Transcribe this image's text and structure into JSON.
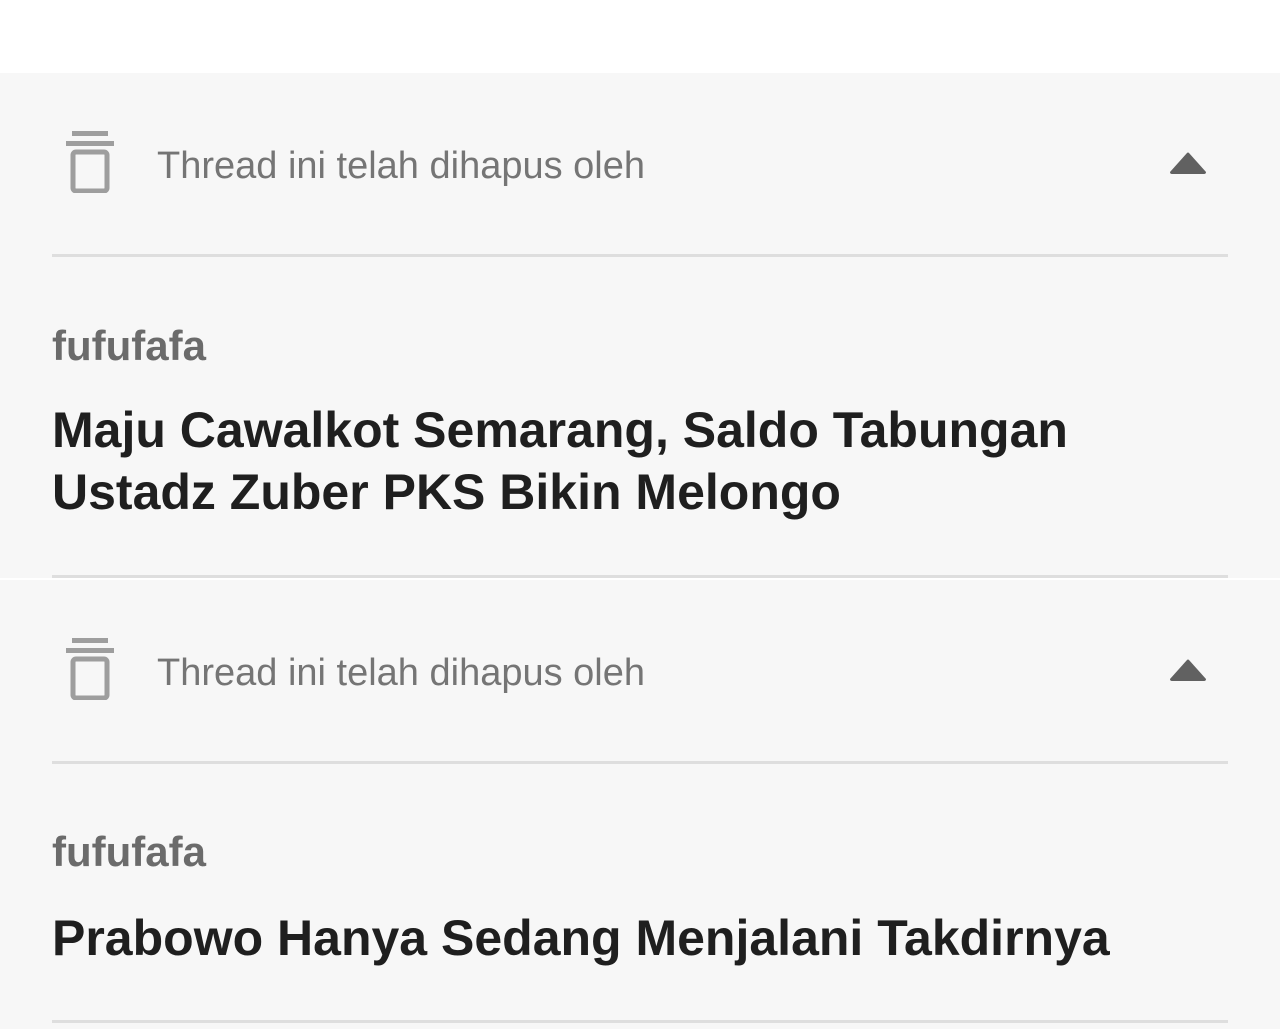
{
  "threads": [
    {
      "deleted_notice": "Thread ini telah dihapus oleh",
      "trash_icon": "trash-icon",
      "collapse_icon": "caret-up-icon",
      "author": "fufufafa",
      "title": "Maju Cawalkot Semarang, Saldo Tabungan Ustadz Zuber PKS Bikin Melongo"
    },
    {
      "deleted_notice": "Thread ini telah dihapus oleh",
      "trash_icon": "trash-icon",
      "collapse_icon": "caret-up-icon",
      "author": "fufufafa",
      "title": "Prabowo Hanya Sedang Menjalani Takdirnya"
    }
  ],
  "colors": {
    "card_background": "#f7f7f7",
    "divider": "#dedede",
    "muted_text": "#757575",
    "title_text": "#1f1f1f"
  }
}
